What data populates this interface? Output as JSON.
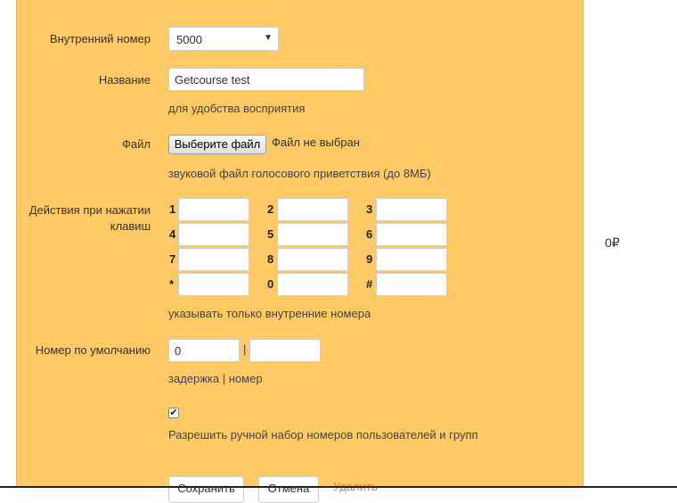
{
  "form": {
    "internal_number_label": "Внутренний номер",
    "internal_number_value": "5000",
    "name_label": "Название",
    "name_value": "Getcourse test",
    "name_hint": "для удобства восприятия",
    "file_label": "Файл",
    "file_button": "Выберите файл",
    "file_status": "Файл не выбран",
    "file_hint": "звуковой файл голосового приветствия (до 8МБ)",
    "keys_label": "Действия при нажатии клавиш",
    "keys": [
      "1",
      "2",
      "3",
      "4",
      "5",
      "6",
      "7",
      "8",
      "9",
      "*",
      "0",
      "#"
    ],
    "keys_hint": "указывать только внутренние номера",
    "default_label": "Номер по умолчанию",
    "default_value": "0",
    "default_separator": "|",
    "default_hint": "задержка | номер",
    "manual_dial_checked": true,
    "manual_dial_label": "Разрешить ручной набор номеров пользователей и групп",
    "save_button": "Сохранить",
    "cancel_button": "Отмена",
    "delete_link": "Удалить"
  },
  "side": {
    "balance": "0₽"
  },
  "colors": {
    "panel_bg": "#ffc965",
    "delete_link": "#e07a5a"
  }
}
